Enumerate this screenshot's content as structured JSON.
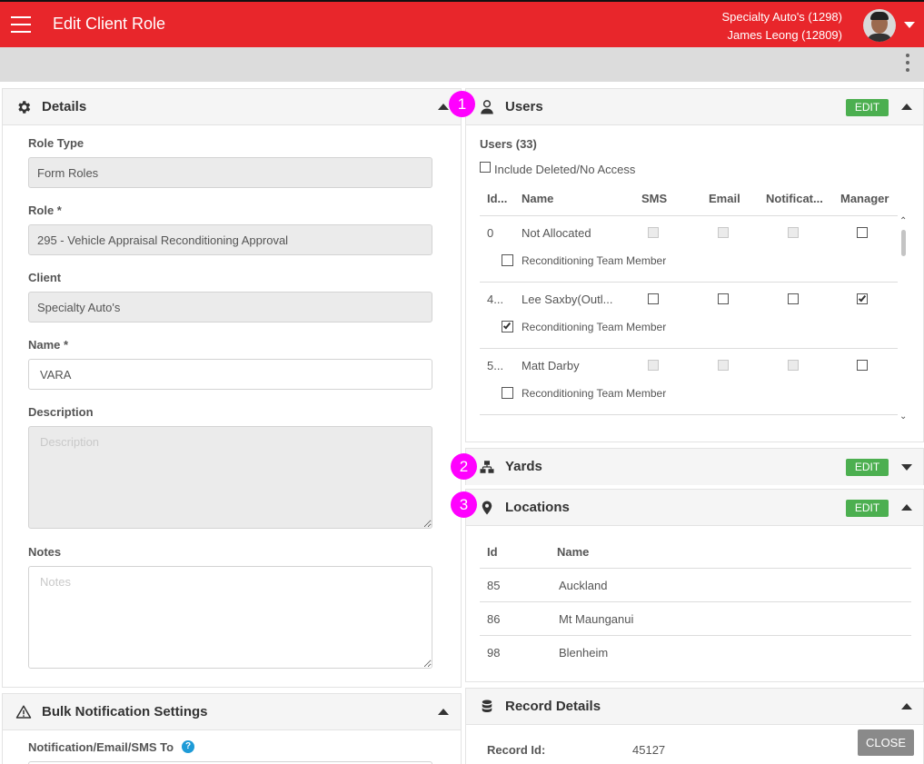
{
  "header": {
    "title": "Edit Client Role",
    "account_line1": "Specialty Auto's (1298)",
    "account_line2": "James Leong (12809)"
  },
  "details": {
    "title": "Details",
    "role_type_label": "Role Type",
    "role_type_value": "Form Roles",
    "role_label": "Role *",
    "role_value": "295 - Vehicle Appraisal Reconditioning Approval",
    "client_label": "Client",
    "client_value": "Specialty Auto's",
    "name_label": "Name *",
    "name_value": "VARA",
    "description_label": "Description",
    "description_placeholder": "Description",
    "notes_label": "Notes",
    "notes_placeholder": "Notes"
  },
  "bulk": {
    "title": "Bulk Notification Settings",
    "field_label": "Notification/Email/SMS To"
  },
  "badges": [
    "1",
    "2",
    "3"
  ],
  "users": {
    "title": "Users",
    "edit_label": "EDIT",
    "count_label": "Users (33)",
    "include_deleted_label": "Include Deleted/No Access",
    "columns": [
      "Id...",
      "Name",
      "SMS",
      "Email",
      "Notificat...",
      "Manager"
    ],
    "rows": [
      {
        "id": "0",
        "name": "Not Allocated",
        "role": "Reconditioning Team Member",
        "sms": false,
        "email": false,
        "notif": false,
        "manager": false,
        "member": false,
        "disabled": true
      },
      {
        "id": "4...",
        "name": "Lee Saxby(Outl...",
        "role": "Reconditioning Team Member",
        "sms": false,
        "email": false,
        "notif": false,
        "manager": true,
        "member": true,
        "disabled": false
      },
      {
        "id": "5...",
        "name": "Matt Darby",
        "role": "Reconditioning Team Member",
        "sms": false,
        "email": false,
        "notif": false,
        "manager": false,
        "member": false,
        "disabled": true
      }
    ]
  },
  "yards": {
    "title": "Yards",
    "edit_label": "EDIT"
  },
  "locations": {
    "title": "Locations",
    "edit_label": "EDIT",
    "columns": [
      "Id",
      "Name"
    ],
    "rows": [
      {
        "id": "85",
        "name": "Auckland"
      },
      {
        "id": "86",
        "name": "Mt Maunganui"
      },
      {
        "id": "98",
        "name": "Blenheim"
      }
    ]
  },
  "record": {
    "title": "Record Details",
    "record_id_label": "Record Id:",
    "record_id_value": "45127"
  },
  "close_label": "CLOSE",
  "colors": {
    "brand": "#e8262b",
    "edit": "#4caf50",
    "badge": "#ff00ff",
    "close": "#8a8a8a"
  }
}
